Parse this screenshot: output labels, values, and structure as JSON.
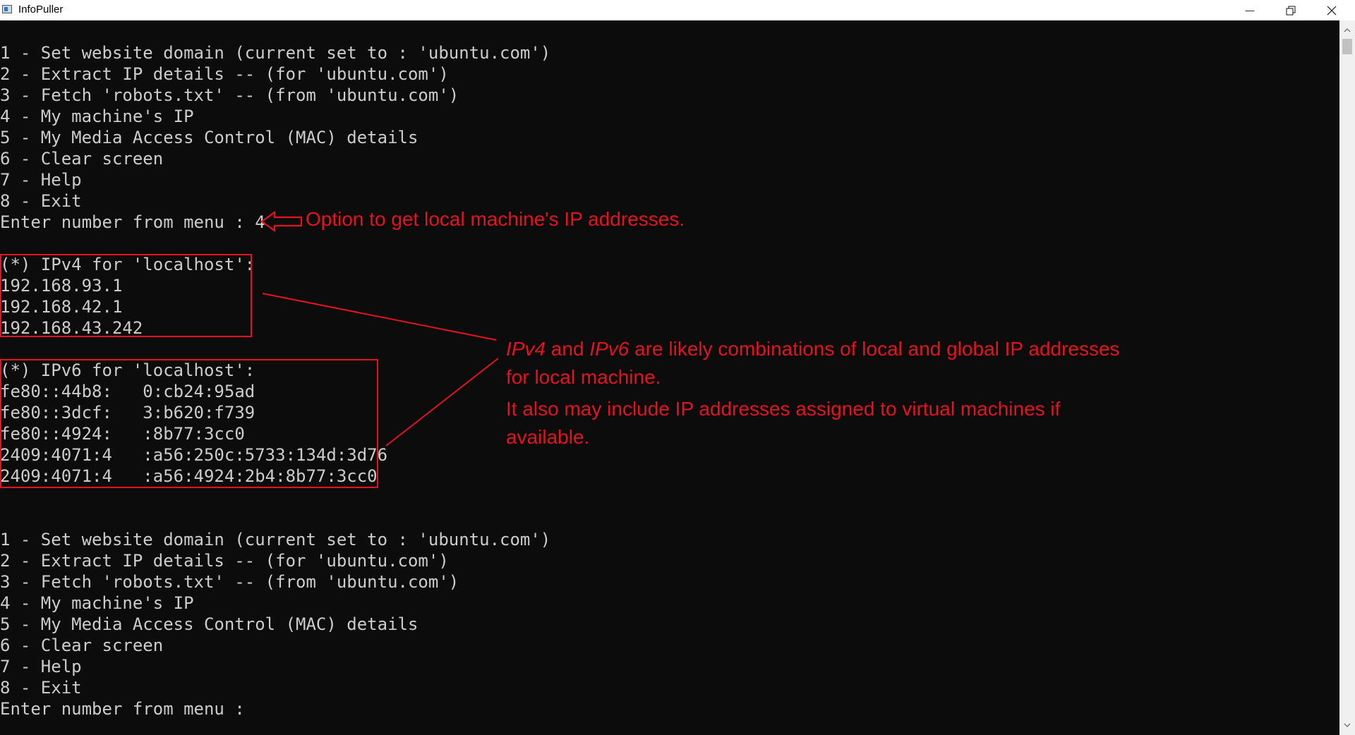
{
  "window": {
    "title": "InfoPuller",
    "minimize_glyph": "—"
  },
  "console": {
    "menu_first": [
      "1 - Set website domain (current set to : 'ubuntu.com')",
      "2 - Extract IP details -- (for 'ubuntu.com')",
      "3 - Fetch 'robots.txt' -- (from 'ubuntu.com')",
      "4 - My machine's IP",
      "5 - My Media Access Control (MAC) details",
      "6 - Clear screen",
      "7 - Help",
      "8 - Exit"
    ],
    "prompt_first": "Enter number from menu : 4",
    "ipv4_header": "(*) IPv4 for 'localhost':",
    "ipv4": [
      "192.168.93.1",
      "192.168.42.1",
      "192.168.43.242"
    ],
    "ipv6_header": "(*) IPv6 for 'localhost':",
    "ipv6": [
      "fe80::44b8:   0:cb24:95ad",
      "fe80::3dcf:   3:b620:f739",
      "fe80::4924:   :8b77:3cc0",
      "2409:4071:4   :a56:250c:5733:134d:3d76",
      "2409:4071:4   :a56:4924:2b4:8b77:3cc0"
    ],
    "menu_second": [
      "1 - Set website domain (current set to : 'ubuntu.com')",
      "2 - Extract IP details -- (for 'ubuntu.com')",
      "3 - Fetch 'robots.txt' -- (from 'ubuntu.com')",
      "4 - My machine's IP",
      "5 - My Media Access Control (MAC) details",
      "6 - Clear screen",
      "7 - Help",
      "8 - Exit"
    ],
    "prompt_second": "Enter number from menu :"
  },
  "annotations": {
    "arrow_note": "Option to get local machine's IP addresses.",
    "ip_note_ipv4": "IPv4",
    "ip_note_and": " and ",
    "ip_note_ipv6": "IPv6",
    "ip_note_rest": " are likely combinations of local and global IP addresses for local machine.",
    "vm_note": "It also may include IP addresses assigned to virtual machines if available.",
    "color": "#e3141f"
  },
  "colors": {
    "console_bg": "#0c0c0c",
    "console_text": "#cccccc"
  }
}
